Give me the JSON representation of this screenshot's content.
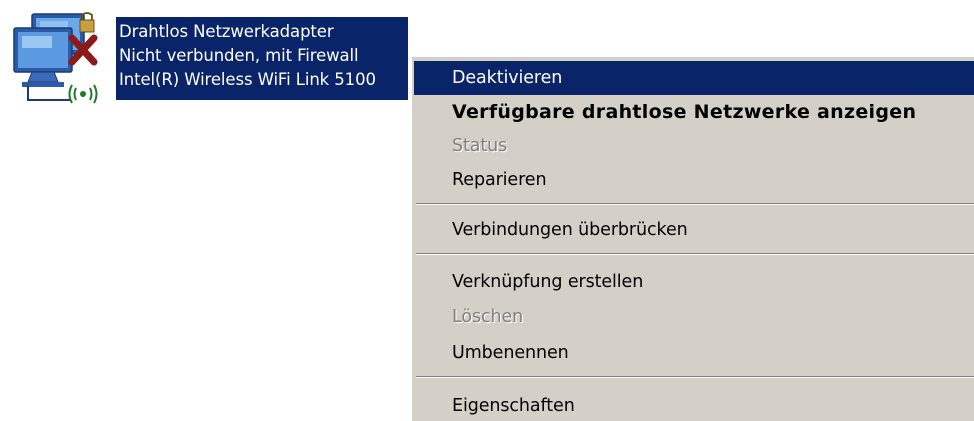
{
  "connection": {
    "icon": "network-adapter-disconnected-icon",
    "lines": [
      "Drahtlos Netzwerkadapter",
      "Nicht verbunden, mit Firewall",
      "Intel(R) Wireless WiFi Link 5100"
    ]
  },
  "menu": {
    "items": [
      {
        "label": "Deaktivieren",
        "state": "highlighted"
      },
      {
        "label": "Verfügbare drahtlose Netzwerke anzeigen",
        "state": "default-bold"
      },
      {
        "label": "Status",
        "state": "disabled"
      },
      {
        "label": "Reparieren",
        "state": "enabled"
      },
      {
        "label": "Verbindungen überbrücken",
        "state": "enabled"
      },
      {
        "label": "Verknüpfung erstellen",
        "state": "enabled"
      },
      {
        "label": "Löschen",
        "state": "disabled"
      },
      {
        "label": "Umbenennen",
        "state": "enabled"
      },
      {
        "label": "Eigenschaften",
        "state": "enabled"
      }
    ]
  },
  "colors": {
    "selection": "#0a246a",
    "menu_background": "#d4d0c8",
    "disabled_text": "#808080",
    "disconnected_x": "#8b1a1a"
  }
}
